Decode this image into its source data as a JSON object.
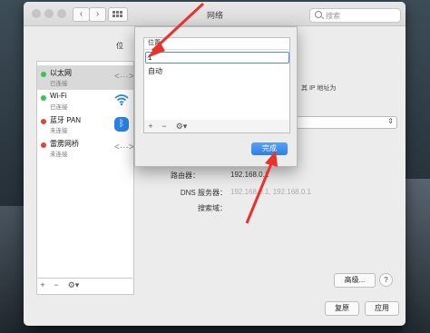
{
  "window": {
    "title": "网络",
    "search_placeholder": "搜索"
  },
  "location_label": "位",
  "sidebar": {
    "services": [
      {
        "name": "以太网",
        "status": "已连接",
        "dot_color": "#34c84a",
        "icon": "ethernet-icon",
        "icon_glyph": "<···>"
      },
      {
        "name": "Wi-Fi",
        "status": "已连接",
        "dot_color": "#34c84a",
        "icon": "wifi-icon",
        "icon_glyph": "◠"
      },
      {
        "name": "蓝牙 PAN",
        "status": "未连接",
        "dot_color": "#e0443c",
        "icon": "bluetooth-icon",
        "icon_glyph": "ᛒ"
      },
      {
        "name": "雷雳网桥",
        "status": "未连接",
        "dot_color": "#e0443c",
        "icon": "thunderbolt-bridge-icon",
        "icon_glyph": "<···>"
      }
    ],
    "footer": {
      "add": "+",
      "remove": "−",
      "action": "⚙▾"
    }
  },
  "detail": {
    "hint_text": "态，其 IP 地址为",
    "router_label": "路由器：",
    "router_value": "192.168.0.1",
    "dns_label": "DNS 服务器：",
    "dns_value": "192.168.0.1, 192.168.0.1",
    "search_domain_label": "搜索域："
  },
  "buttons": {
    "advanced": "高级...",
    "help": "?",
    "revert": "复原",
    "apply": "应用"
  },
  "location_sheet": {
    "column_header": "位置",
    "editing_value": "1",
    "rows": [
      "自动"
    ],
    "footer": {
      "add": "+",
      "remove": "−",
      "action": "⚙▾"
    },
    "done_label": "完成"
  },
  "colors": {
    "accent": "#2f7ee8",
    "annotation_arrow": "#e8322c"
  }
}
